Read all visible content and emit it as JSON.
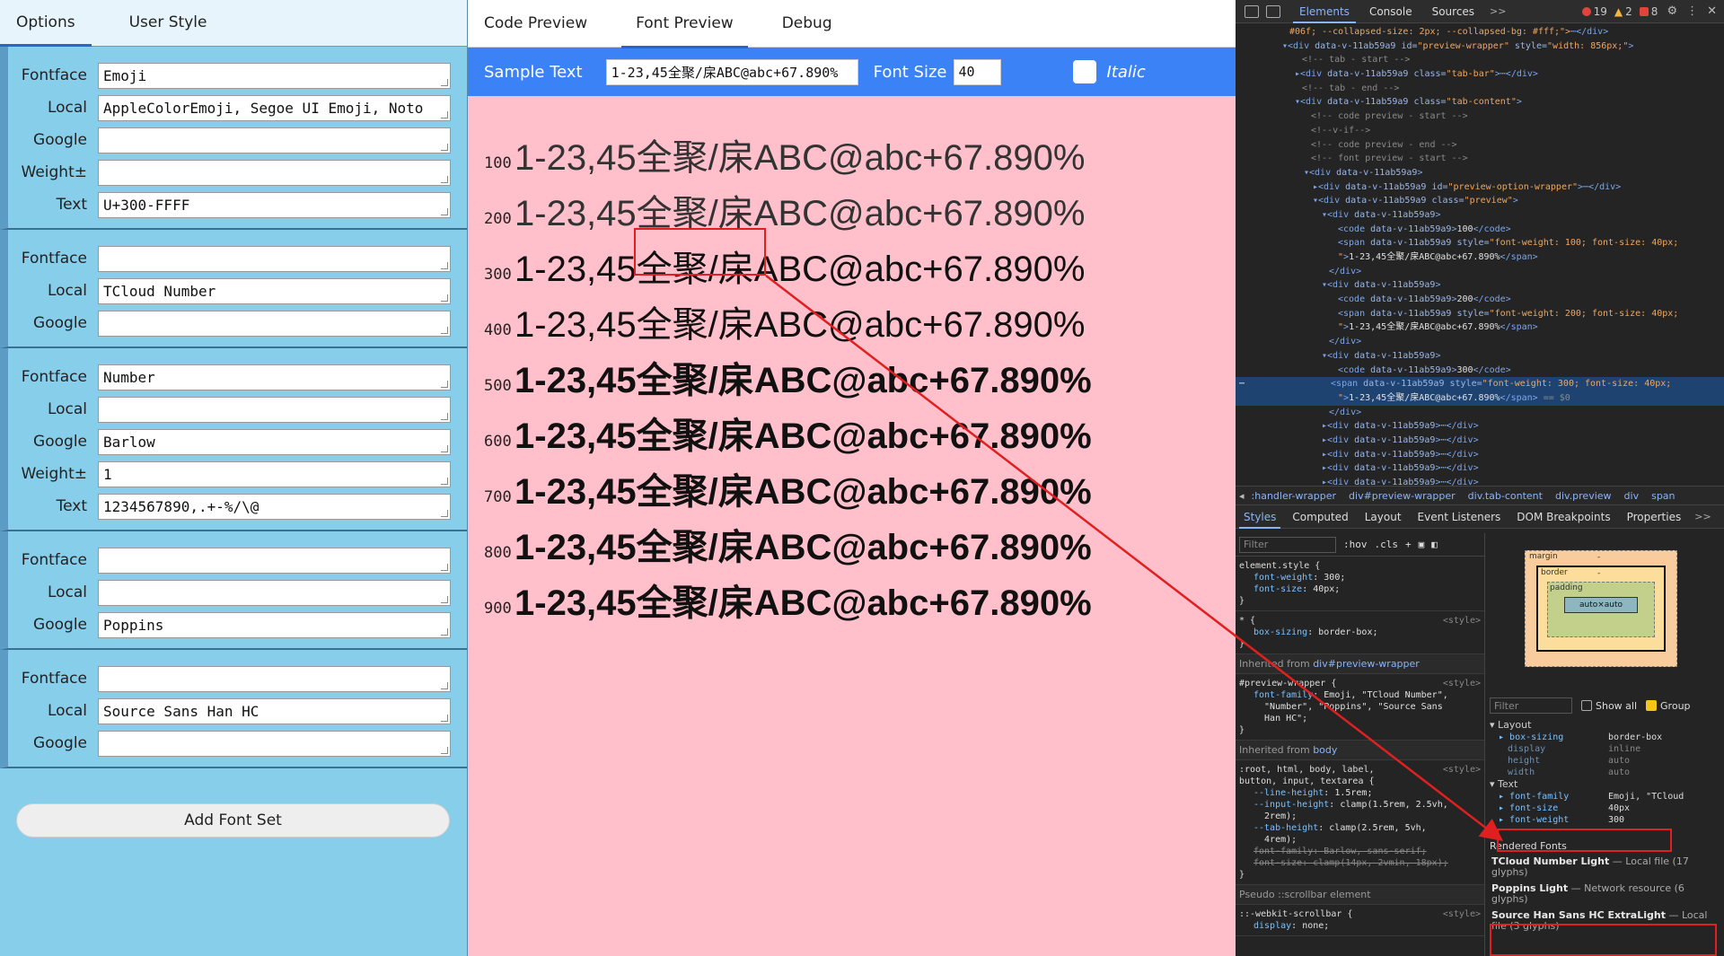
{
  "left": {
    "tabs": [
      "Options",
      "User Style"
    ],
    "fontsets": [
      {
        "rows": [
          {
            "label": "Fontface",
            "value": "Emoji"
          },
          {
            "label": "Local",
            "value": "AppleColorEmoji, Segoe UI Emoji, Noto"
          },
          {
            "label": "Google",
            "value": ""
          },
          {
            "label": "Weight±",
            "value": ""
          },
          {
            "label": "Text",
            "value": "U+300-FFFF"
          }
        ]
      },
      {
        "rows": [
          {
            "label": "Fontface",
            "value": ""
          },
          {
            "label": "Local",
            "value": "TCloud Number"
          },
          {
            "label": "Google",
            "value": ""
          }
        ]
      },
      {
        "rows": [
          {
            "label": "Fontface",
            "value": "Number"
          },
          {
            "label": "Local",
            "value": ""
          },
          {
            "label": "Google",
            "value": "Barlow"
          },
          {
            "label": "Weight±",
            "value": "1"
          },
          {
            "label": "Text",
            "value": "1234567890,.+-%/\\@"
          }
        ]
      },
      {
        "rows": [
          {
            "label": "Fontface",
            "value": ""
          },
          {
            "label": "Local",
            "value": ""
          },
          {
            "label": "Google",
            "value": "Poppins"
          }
        ]
      },
      {
        "rows": [
          {
            "label": "Fontface",
            "value": ""
          },
          {
            "label": "Local",
            "value": "Source Sans Han HC"
          },
          {
            "label": "Google",
            "value": ""
          }
        ]
      }
    ],
    "add_button": "Add Font Set"
  },
  "middle": {
    "tabs": [
      "Code Preview",
      "Font Preview",
      "Debug"
    ],
    "options": {
      "sample_label": "Sample Text",
      "sample_value": "1-23,45全聚/㦿ABC@abc+67.890%",
      "size_label": "Font Size",
      "size_value": "40",
      "italic_label": "Italic"
    },
    "preview_text": "1-23,45全聚/㦿ABC@abc+67.890%",
    "weights": [
      "100",
      "200",
      "300",
      "400",
      "500",
      "600",
      "700",
      "800",
      "900"
    ]
  },
  "devtools": {
    "tabs": [
      "Elements",
      "Console",
      "Sources"
    ],
    "more": ">>",
    "badges": {
      "errors": "19",
      "warnings": "2",
      "issues": "8"
    },
    "breadcrumb": [
      ":handler-wrapper",
      "div#preview-wrapper",
      "div.tab-content",
      "div.preview",
      "div",
      "span"
    ],
    "sub_tabs": [
      "Styles",
      "Computed",
      "Layout",
      "Event Listeners",
      "DOM Breakpoints",
      "Properties"
    ],
    "filter_placeholder": "Filter",
    "hov": ":hov",
    "cls": ".cls",
    "show_all": "Show all",
    "group": "Group",
    "box": {
      "margin": "margin",
      "border": "border",
      "padding": "padding",
      "content": "auto×auto",
      "dash": "-"
    },
    "computed": {
      "layout_group": "Layout",
      "layout": [
        {
          "prop": "box-sizing",
          "val": "border-box",
          "dim": false
        },
        {
          "prop": "display",
          "val": "inline",
          "dim": true
        },
        {
          "prop": "height",
          "val": "auto",
          "dim": true
        },
        {
          "prop": "width",
          "val": "auto",
          "dim": true
        }
      ],
      "text_group": "Text",
      "text": [
        {
          "prop": "font-family",
          "val": "Emoji, \"TCloud"
        },
        {
          "prop": "font-size",
          "val": "40px"
        },
        {
          "prop": "font-weight",
          "val": "300"
        }
      ]
    },
    "rendered_fonts": {
      "title": "Rendered Fonts",
      "items": [
        {
          "name": "TCloud Number Light",
          "desc": " — Local file (17 glyphs)"
        },
        {
          "name": "Poppins Light",
          "desc": " — Network resource (6 glyphs)"
        },
        {
          "name": "Source Han Sans HC ExtraLight",
          "desc": " — Local file (3 glyphs)"
        }
      ]
    }
  },
  "colors": {
    "left_bg": "#87ceeb",
    "preview_bg": "#ffc0cb",
    "options_bar": "#3b82f6",
    "annotation_red": "#e02020"
  }
}
